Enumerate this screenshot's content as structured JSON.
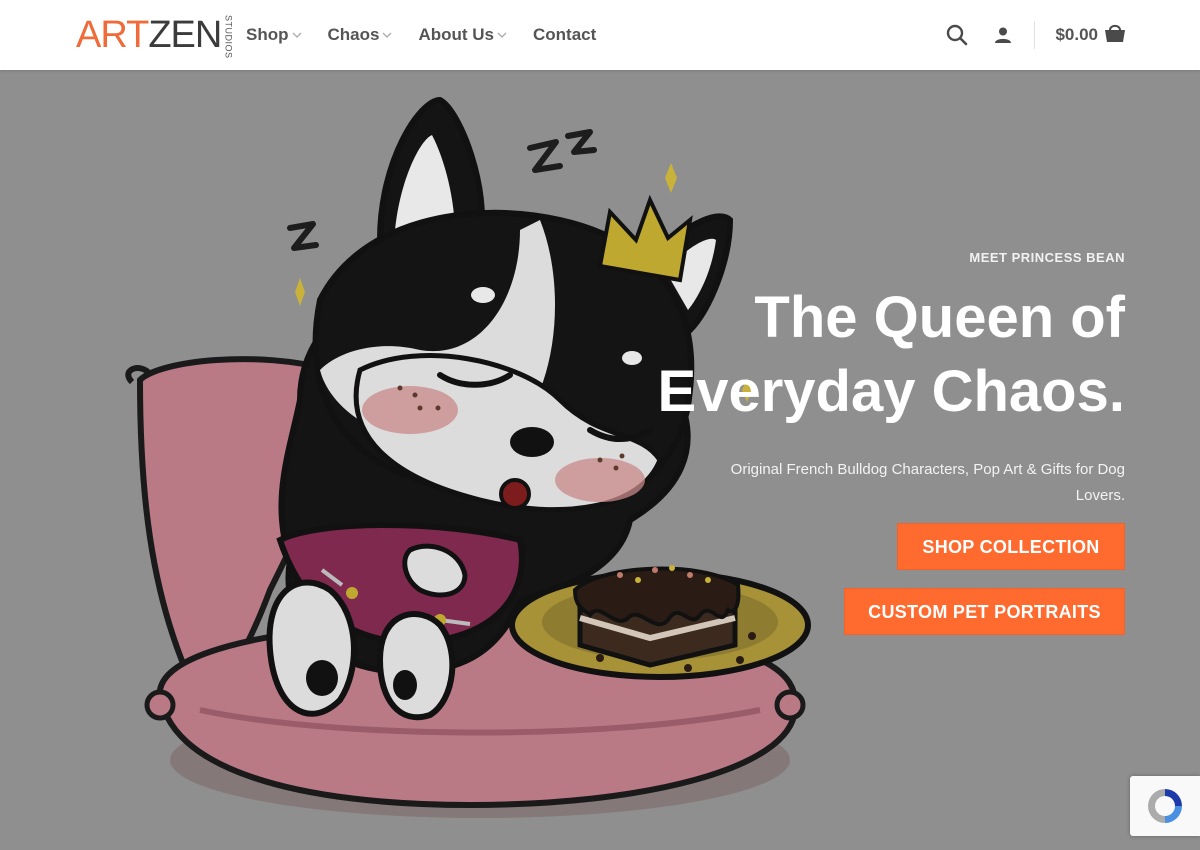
{
  "header": {
    "logo": {
      "main_art": "ART",
      "main_zen": "ZEN",
      "sub": "STUDIOS"
    },
    "nav": [
      {
        "label": "Shop",
        "has_dropdown": true
      },
      {
        "label": "Chaos",
        "has_dropdown": true
      },
      {
        "label": "About Us",
        "has_dropdown": true
      },
      {
        "label": "Contact",
        "has_dropdown": false
      }
    ],
    "cart_amount": "$0.00",
    "icons": {
      "search": "search-icon",
      "account": "user-icon",
      "cart": "shopping-bag-icon"
    }
  },
  "hero": {
    "eyebrow": "MEET PRINCESS BEAN",
    "headline_line1": "The Queen of",
    "headline_line2": "Everyday Chaos.",
    "subline": "Original French Bulldog Characters, Pop Art & Gifts for Dog Lovers.",
    "buttons": {
      "shop": "SHOP COLLECTION",
      "portraits": "CUSTOM PET PORTRAITS"
    }
  },
  "colors": {
    "accent": "#ff6a2f",
    "logo_orange": "#ef6b3a",
    "overlay_gray": "#8f8f8f",
    "nav_text": "#555555"
  }
}
